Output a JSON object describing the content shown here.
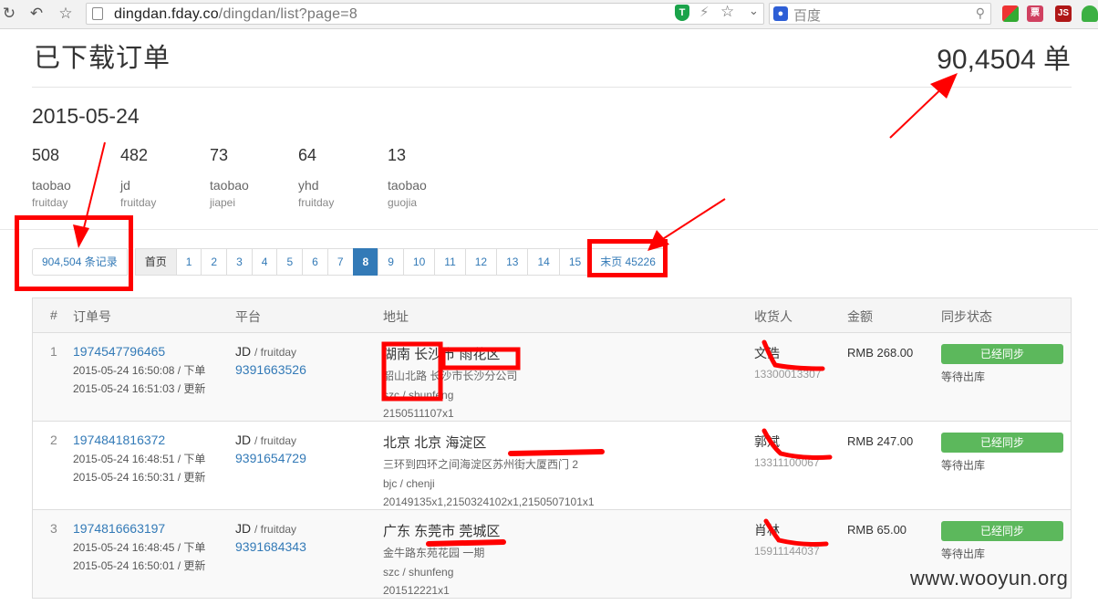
{
  "browser": {
    "url_host": "dingdan.fday.co",
    "url_path": "/dingdan/list?page=8",
    "search_placeholder": "百度",
    "ext_labels": {
      "tickets": "票",
      "js": "JS"
    }
  },
  "page": {
    "title": "已下载订单",
    "total_count": "90,4504 单",
    "date_heading": "2015-05-24"
  },
  "stats": [
    {
      "count": "508",
      "platform": "taobao",
      "source": "fruitday"
    },
    {
      "count": "482",
      "platform": "jd",
      "source": "fruitday"
    },
    {
      "count": "73",
      "platform": "taobao",
      "source": "jiapei"
    },
    {
      "count": "64",
      "platform": "yhd",
      "source": "fruitday"
    },
    {
      "count": "13",
      "platform": "taobao",
      "source": "guojia"
    }
  ],
  "pagination": {
    "record_count": "904,504 条记录",
    "first_label": "首页",
    "pages": [
      "1",
      "2",
      "3",
      "4",
      "5",
      "6",
      "7",
      "8",
      "9",
      "10",
      "11",
      "12",
      "13",
      "14",
      "15"
    ],
    "current_page": "8",
    "last_label": "末页 45226"
  },
  "table": {
    "headers": {
      "index": "#",
      "order": "订单号",
      "platform": "平台",
      "address": "地址",
      "receiver": "收货人",
      "amount": "金额",
      "sync": "同步状态"
    },
    "rows": [
      {
        "index": "1",
        "order_id": "1974547796465",
        "ordered_at": "2015-05-24 16:50:08 / 下单",
        "updated_at": "2015-05-24 16:51:03 / 更新",
        "platform": "JD",
        "platform_source": "/ fruitday",
        "platform_order": "9391663526",
        "region": "湖南 长沙市 雨花区",
        "street": "韶山北路 长沙市长沙分公司",
        "shipping": "szc / shunfeng",
        "items": "2150511107x1",
        "receiver": "文浩",
        "phone": "13300013307",
        "amount": "RMB 268.00",
        "sync_label": "已经同步",
        "status": "等待出库"
      },
      {
        "index": "2",
        "order_id": "1974841816372",
        "ordered_at": "2015-05-24 16:48:51 / 下单",
        "updated_at": "2015-05-24 16:50:31 / 更新",
        "platform": "JD",
        "platform_source": "/ fruitday",
        "platform_order": "9391654729",
        "region": "北京 北京 海淀区",
        "street": "三环到四环之间海淀区苏州街大厦西门 2",
        "shipping": "bjc / chenji",
        "items": "20149135x1,2150324102x1,2150507101x1",
        "receiver": "郭斌",
        "phone": "13311100067",
        "amount": "RMB 247.00",
        "sync_label": "已经同步",
        "status": "等待出库"
      },
      {
        "index": "3",
        "order_id": "1974816663197",
        "ordered_at": "2015-05-24 16:48:45 / 下单",
        "updated_at": "2015-05-24 16:50:01 / 更新",
        "platform": "JD",
        "platform_source": "/ fruitday",
        "platform_order": "9391684343",
        "region": "广东 东莞市 莞城区",
        "street": "金牛路东苑花园 一期",
        "shipping": "szc / shunfeng",
        "items": "201512221x1",
        "receiver": "肖林",
        "phone": "15911144037",
        "amount": "RMB 65.00",
        "sync_label": "已经同步",
        "status": "等待出库"
      }
    ]
  },
  "watermark": "www.wooyun.org",
  "colors": {
    "link": "#337ab7",
    "success": "#5cb85c",
    "annotation": "#ff0000"
  }
}
